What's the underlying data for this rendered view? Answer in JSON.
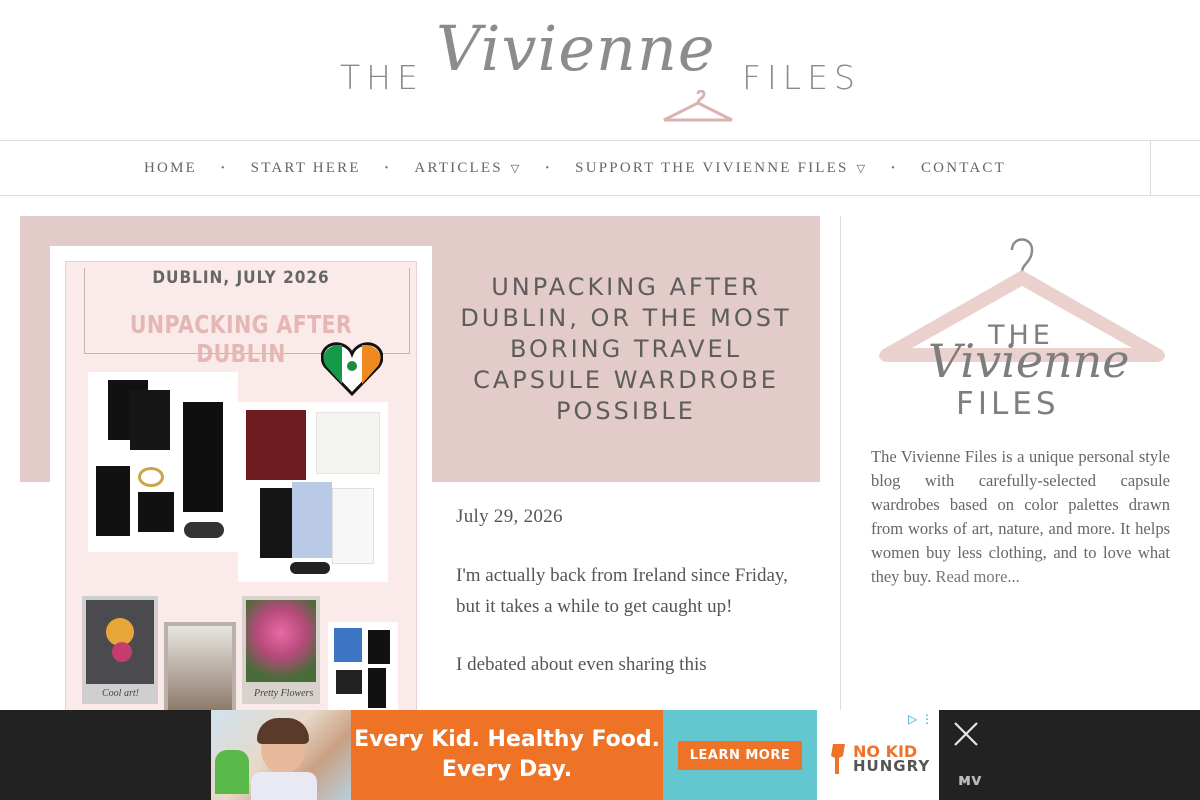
{
  "header": {
    "logo": {
      "left": "THE",
      "script": "Vivienne",
      "right": "FILES"
    }
  },
  "nav": {
    "items": [
      {
        "label": "HOME",
        "caret": false
      },
      {
        "label": "START HERE",
        "caret": false
      },
      {
        "label": "ARTICLES",
        "caret": true
      },
      {
        "label": "SUPPORT THE VIVIENNE FILES",
        "caret": true
      },
      {
        "label": "CONTACT",
        "caret": false
      }
    ],
    "separator": "•",
    "caret_glyph": "▽"
  },
  "post": {
    "title": "UNPACKING AFTER DUBLIN, OR THE MOST BORING TRAVEL CAPSULE WARDROBE POSSIBLE",
    "date": "July 29, 2026",
    "paragraphs": [
      "I'm actually back from Ireland since Friday, but it takes a while to get caught up!",
      "I debated about even sharing this"
    ],
    "image": {
      "date_line": "DUBLIN, JULY 2026",
      "title_line": "UNPACKING AFTER DUBLIN",
      "captions": [
        "Cool art!",
        "Pretty Flowers"
      ]
    }
  },
  "sidebar": {
    "logo": {
      "top": "THE",
      "script": "Vivienne",
      "bottom": "FILES"
    },
    "about_text": "The Vivienne Files is a unique personal style blog with carefully-selected capsule wardrobes based on color palettes drawn from works of art, nature, and more. It helps women buy less clothing, and to love what they buy.",
    "read_more": "Read more..."
  },
  "ad": {
    "headline_1": "Every Kid. Healthy Food.",
    "headline_2": "Every Day.",
    "cta": "LEARN MORE",
    "brand_1": "NO KID",
    "brand_2": "HUNGRY",
    "adchoices": "▷ ⋮",
    "close": "close-icon"
  },
  "colors": {
    "band": "#e2cbc9",
    "ad_orange": "#ee7326",
    "ad_teal": "#63c7cf",
    "ad_bar": "#222222"
  }
}
